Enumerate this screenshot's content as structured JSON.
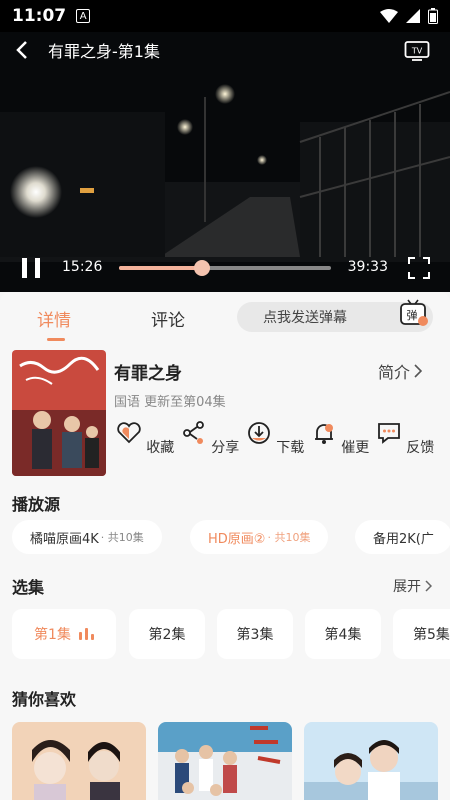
{
  "status": {
    "time": "11:07",
    "badge": "A"
  },
  "player": {
    "title": "有罪之身-第1集",
    "current_time": "15:26",
    "total_time": "39:33",
    "progress": 0.39
  },
  "tabs": {
    "details": "详情",
    "comments": "评论"
  },
  "danmaku": {
    "placeholder": "点我发送弹幕",
    "icon_label": "弹"
  },
  "show": {
    "title": "有罪之身",
    "intro_label": "简介",
    "meta": "国语 更新至第04集"
  },
  "actions": [
    {
      "label": "收藏",
      "icon": "heart-icon"
    },
    {
      "label": "分享",
      "icon": "share-icon"
    },
    {
      "label": "下载",
      "icon": "download-icon"
    },
    {
      "label": "催更",
      "icon": "bell-icon"
    },
    {
      "label": "反馈",
      "icon": "feedback-icon"
    }
  ],
  "sources_title": "播放源",
  "sources": [
    {
      "name": "橘喵原画4K",
      "count": "· 共10集"
    },
    {
      "name": "HD原画②",
      "count": "· 共10集"
    },
    {
      "name": "备用2K(广",
      "count": ""
    }
  ],
  "episodes_title": "选集",
  "expand_label": "展开",
  "episodes": [
    "第1集",
    "第2集",
    "第3集",
    "第4集",
    "第5集"
  ],
  "recommend_title": "猜你喜欢",
  "colors": {
    "accent": "#f08a5d",
    "bg": "#f7f7f7"
  }
}
